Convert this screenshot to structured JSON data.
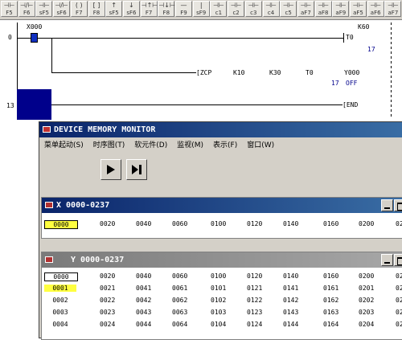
{
  "toolbar": {
    "buttons": [
      {
        "sym": "⊣⊢",
        "label": "F5"
      },
      {
        "sym": "⊣/⊢",
        "label": "F6"
      },
      {
        "sym": "⊣⊢",
        "label": "sF5"
      },
      {
        "sym": "⊣/⊢",
        "label": "sF6"
      },
      {
        "sym": "( )",
        "label": "F7"
      },
      {
        "sym": "[ ]",
        "label": "F8"
      },
      {
        "sym": "↑",
        "label": "sF5"
      },
      {
        "sym": "↓",
        "label": "sF6"
      },
      {
        "sym": "⊣↑⊢",
        "label": "F7"
      },
      {
        "sym": "⊣↓⊢",
        "label": "F8"
      },
      {
        "sym": "—",
        "label": "F9"
      },
      {
        "sym": "|",
        "label": "sF9"
      },
      {
        "sym": "⊣⊢",
        "label": "c1"
      },
      {
        "sym": "⊣⊢",
        "label": "c2"
      },
      {
        "sym": "⊣⊢",
        "label": "c3"
      },
      {
        "sym": "⊣⊢",
        "label": "c4"
      },
      {
        "sym": "⊣⊢",
        "label": "c5"
      },
      {
        "sym": "⊣⊢",
        "label": "aF7"
      },
      {
        "sym": "⊣⊢",
        "label": "aF8"
      },
      {
        "sym": "⊣⊢",
        "label": "aF9"
      },
      {
        "sym": "⊣⊢",
        "label": "aF5"
      },
      {
        "sym": "⊣⊢",
        "label": "aF6"
      },
      {
        "sym": "⊣⊢",
        "label": "aF7"
      }
    ]
  },
  "ladder": {
    "step0": "0",
    "contact0": "X000",
    "coil_t0": "T0",
    "k60": "K60",
    "t0_value": "17",
    "zcp": "[ZCP",
    "k10": "K10",
    "k30": "K30",
    "t0_ref": "T0",
    "y000": "Y000",
    "zcp_value": "17",
    "off": "OFF",
    "step13": "13",
    "end": "END"
  },
  "dmm": {
    "title": "DEVICE MEMORY MONITOR",
    "menu": [
      "菜单起动(S)",
      "时序图(T)",
      "软元件(D)",
      "监视(M)",
      "表示(F)",
      "窗口(W)"
    ],
    "x_window": {
      "title": "X  0000-0237",
      "cells": [
        "0000",
        "0020",
        "0040",
        "0060",
        "0100",
        "0120",
        "0140",
        "0160",
        "0200",
        "02"
      ]
    },
    "y_window": {
      "title": "Y  0000-0237",
      "rows": [
        [
          "0000",
          "0020",
          "0040",
          "0060",
          "0100",
          "0120",
          "0140",
          "0160",
          "0200",
          "02"
        ],
        [
          "0001",
          "0021",
          "0041",
          "0061",
          "0101",
          "0121",
          "0141",
          "0161",
          "0201",
          "02"
        ],
        [
          "0002",
          "0022",
          "0042",
          "0062",
          "0102",
          "0122",
          "0142",
          "0162",
          "0202",
          "02"
        ],
        [
          "0003",
          "0023",
          "0043",
          "0063",
          "0103",
          "0123",
          "0143",
          "0163",
          "0203",
          "02"
        ],
        [
          "0004",
          "0024",
          "0044",
          "0064",
          "0104",
          "0124",
          "0144",
          "0164",
          "0204",
          "02"
        ]
      ]
    }
  },
  "colors": {
    "accent": "#0a246a",
    "highlight": "#ffff40",
    "cursor": "#00008b"
  }
}
